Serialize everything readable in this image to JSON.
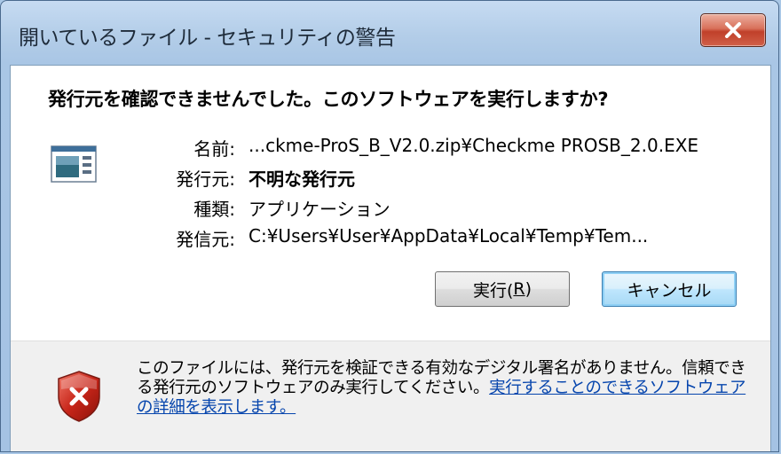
{
  "window": {
    "title": "開いているファイル - セキュリティの警告"
  },
  "dialog": {
    "headline": "発行元を確認できませんでした。このソフトウェアを実行しますか?",
    "fields": [
      {
        "label": "名前:",
        "value": "...ckme-ProS_B_V2.0.zip¥Checkme PROSB_2.0.EXE"
      },
      {
        "label": "発行元:",
        "value": "不明な発行元"
      },
      {
        "label": "種類:",
        "value": "アプリケーション"
      },
      {
        "label": "発信元:",
        "value": "C:¥Users¥User¥AppData¥Local¥Temp¥Tem..."
      }
    ],
    "buttons": {
      "run_label": "実行(",
      "run_mnemonic": "R",
      "run_suffix": ")",
      "cancel_label": "キャンセル"
    }
  },
  "footer": {
    "warning_text": "このファイルには、発行元を検証できる有効なデジタル署名がありません。信頼できる発行元のソフトウェアのみ実行してください。",
    "link_text": "実行することのできるソフトウェアの詳細を表示します。"
  },
  "colors": {
    "title_bar": "#b3cde8",
    "close_button": "#c0402a",
    "link": "#0645ad",
    "footer_bg": "#f0f0f0"
  },
  "icons": {
    "close": "close-x-icon",
    "app": "application-window-icon",
    "warning": "security-shield-error-icon"
  }
}
